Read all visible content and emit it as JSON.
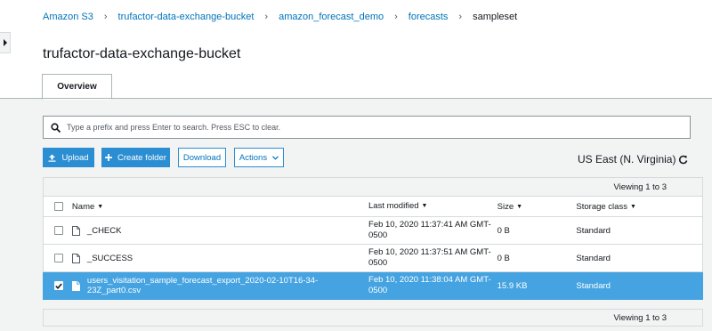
{
  "breadcrumb": {
    "items": [
      "Amazon S3",
      "trufactor-data-exchange-bucket",
      "amazon_forecast_demo",
      "forecasts",
      "sampleset"
    ],
    "separator": "›"
  },
  "bucket": {
    "title": "trufactor-data-exchange-bucket"
  },
  "tabs": {
    "overview": "Overview"
  },
  "search": {
    "placeholder": "Type a prefix and press Enter to search. Press ESC to clear.",
    "icon": "search-icon"
  },
  "toolbar": {
    "upload_label": "Upload",
    "create_folder_label": "Create folder",
    "download_label": "Download",
    "actions_label": "Actions"
  },
  "region": {
    "label": "US East (N. Virginia)",
    "refresh_icon": "refresh-icon"
  },
  "table": {
    "viewing_top": "Viewing 1 to 3",
    "viewing_bottom": "Viewing 1 to 3",
    "headers": {
      "name": "Name",
      "last_modified": "Last modified",
      "size": "Size",
      "storage_class": "Storage class"
    },
    "rows": [
      {
        "name": "_CHECK",
        "modified_line1": "Feb 10, 2020 11:37:41 AM GMT-",
        "modified_line2": "0500",
        "size": "0 B",
        "storage_class": "Standard",
        "selected": false
      },
      {
        "name": "_SUCCESS",
        "modified_line1": "Feb 10, 2020 11:37:51 AM GMT-",
        "modified_line2": "0500",
        "size": "0 B",
        "storage_class": "Standard",
        "selected": false
      },
      {
        "name": "users_visitation_sample_forecast_export_2020-02-10T16-34-23Z_part0.csv",
        "modified_line1": "Feb 10, 2020 11:38:04 AM GMT-",
        "modified_line2": "0500",
        "size": "15.9 KB",
        "storage_class": "Standard",
        "selected": true
      }
    ]
  },
  "colors": {
    "primary": "#2b8ed2",
    "link": "#0073bb",
    "selected_row": "#44a3e0",
    "background": "#f2f3f3"
  }
}
